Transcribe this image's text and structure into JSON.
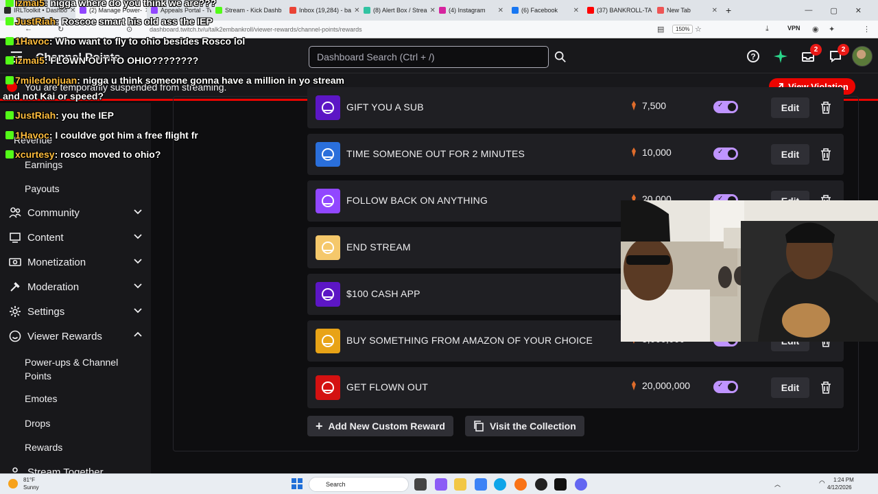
{
  "browser": {
    "tabs": [
      {
        "label": "IRLToolkit • Dashbo",
        "color": "#2a2a2a"
      },
      {
        "label": "(2) Manage Power-",
        "color": "#9146ff"
      },
      {
        "label": "Appeals Portal - Tw",
        "color": "#9146ff"
      },
      {
        "label": "Stream - Kick Dashb",
        "color": "#53fc18"
      },
      {
        "label": "Inbox (19,284) - ba",
        "color": "#ea4335"
      },
      {
        "label": "(8) Alert Box / Strea",
        "color": "#31c3a2"
      },
      {
        "label": "(4) Instagram",
        "color": "#d6249f"
      },
      {
        "label": "(6) Facebook",
        "color": "#1877f2"
      },
      {
        "label": "(37) BANKROLL-TA",
        "color": "#ff0000"
      },
      {
        "label": "New Tab",
        "color": "#e55"
      }
    ],
    "url": "dashboard.twitch.tv/u/talk2embankroll/viewer-rewards/channel-points/rewards",
    "zoom": "150%",
    "vpn_label": "VPN"
  },
  "topnav": {
    "brand": "Channel Points",
    "search_placeholder": "Dashboard Search (Ctrl + /)",
    "inbox_badge": "2",
    "whispers_badge": "2"
  },
  "banner": {
    "text": "You are temporarily suspended from streaming.",
    "button": "View Violation"
  },
  "sidebar": {
    "top_items": [
      "Revenue",
      "Earnings",
      "Payouts"
    ],
    "items": [
      {
        "label": "Community",
        "icon": "community-icon",
        "expanded": false
      },
      {
        "label": "Content",
        "icon": "content-icon",
        "expanded": false
      },
      {
        "label": "Monetization",
        "icon": "monetization-icon",
        "expanded": false
      },
      {
        "label": "Moderation",
        "icon": "moderation-icon",
        "expanded": false
      },
      {
        "label": "Settings",
        "icon": "gear-icon",
        "expanded": false
      },
      {
        "label": "Viewer Rewards",
        "icon": "smile-icon",
        "expanded": true
      }
    ],
    "sub_items": [
      "Power-ups & Channel Points",
      "Emotes",
      "Drops",
      "Rewards"
    ],
    "bottom_item": "Stream Together"
  },
  "rewards": [
    {
      "name": "GIFT YOU A SUB",
      "cost": "7,500",
      "enabled": true,
      "icon_bg": "#5c16c5"
    },
    {
      "name": "TIME SOMEONE OUT FOR 2 MINUTES",
      "cost": "10,000",
      "enabled": true,
      "icon_bg": "#2a6fdb"
    },
    {
      "name": "FOLLOW BACK ON ANYTHING",
      "cost": "20,000",
      "enabled": true,
      "icon_bg": "#9147ff"
    },
    {
      "name": "END STREAM",
      "cost": "",
      "enabled": true,
      "icon_bg": "#f5c86b"
    },
    {
      "name": "$100 CASH APP",
      "cost": "",
      "enabled": true,
      "icon_bg": "#5c16c5"
    },
    {
      "name": "BUY SOMETHING FROM AMAZON OF YOUR CHOICE",
      "cost": "5,000,000",
      "enabled": true,
      "icon_bg": "#e8a317"
    },
    {
      "name": "GET FLOWN OUT",
      "cost": "20,000,000",
      "enabled": true,
      "icon_bg": "#d41111"
    }
  ],
  "actions": {
    "edit_label": "Edit",
    "add_label": "Add New Custom Reward",
    "collection_label": "Visit the Collection"
  },
  "chat": [
    {
      "user": "izmai5",
      "msg": ": nigga where do you think we are???"
    },
    {
      "user": "JustRiah",
      "msg": ": Roscoe smart his old ass the IEP"
    },
    {
      "user": "1Havoc",
      "msg": ": Who want to fly to ohio besides Rosco lol"
    },
    {
      "user": "izmai5",
      "msg": ": FLOWN OUT TO OHIO????????"
    },
    {
      "user": "7miledonjuan",
      "msg": ": nigga u think someone gonna have a million in yo stream"
    },
    {
      "user": "",
      "msg": "and not Kai or speed?"
    },
    {
      "user": "JustRiah",
      "msg": ": you the IEP"
    },
    {
      "user": "1Havoc",
      "msg": ": I couldve got him a free flight fr"
    },
    {
      "user": "xcurtesy",
      "msg": ": rosco moved to ohio?"
    }
  ],
  "taskbar": {
    "weather_temp": "81°F",
    "weather_desc": "Sunny",
    "search_label": "Search",
    "time": "1:24 PM",
    "date": "4/12/2026"
  },
  "colors": {
    "accent": "#bf94ff",
    "danger": "#eb0400",
    "panel": "#1f1f23"
  }
}
